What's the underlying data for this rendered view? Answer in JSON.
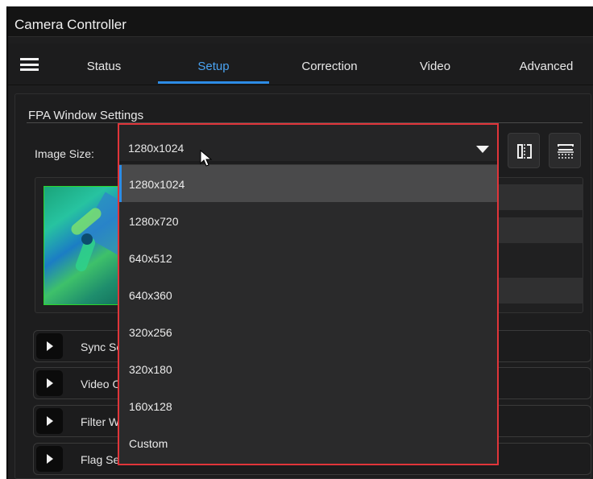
{
  "app": {
    "title": "Camera Controller"
  },
  "nav": {
    "menu_icon": "hamburger-menu-icon",
    "tabs": [
      {
        "label": "Status",
        "active": false
      },
      {
        "label": "Setup",
        "active": true
      },
      {
        "label": "Correction",
        "active": false
      },
      {
        "label": "Video",
        "active": false
      },
      {
        "label": "Advanced",
        "active": false
      }
    ]
  },
  "fpa": {
    "section_title": "FPA Window Settings",
    "image_size_label": "Image Size:",
    "image_size_value": "1280x1024",
    "image_size_options": [
      "1280x1024",
      "1280x720",
      "640x512",
      "640x360",
      "320x256",
      "320x180",
      "160x128",
      "Custom"
    ],
    "selected_option": "1280x1024",
    "flip_horizontal_icon": "flip-horizontal-icon",
    "flip_vertical_icon": "flip-vertical-icon"
  },
  "accordion": {
    "items": [
      {
        "label": "Sync Settings",
        "visible_text": "Sync Set"
      },
      {
        "label": "Video Output",
        "visible_text": "Video Ou"
      },
      {
        "label": "Filter Wheel",
        "visible_text": "Filter Wh"
      },
      {
        "label": "Flag Settings",
        "visible_text": "Flag Sett"
      }
    ]
  },
  "colors": {
    "accent": "#2d8ce6",
    "dropdown_highlight_border": "#e0353a",
    "background": "#1e1e1f"
  }
}
